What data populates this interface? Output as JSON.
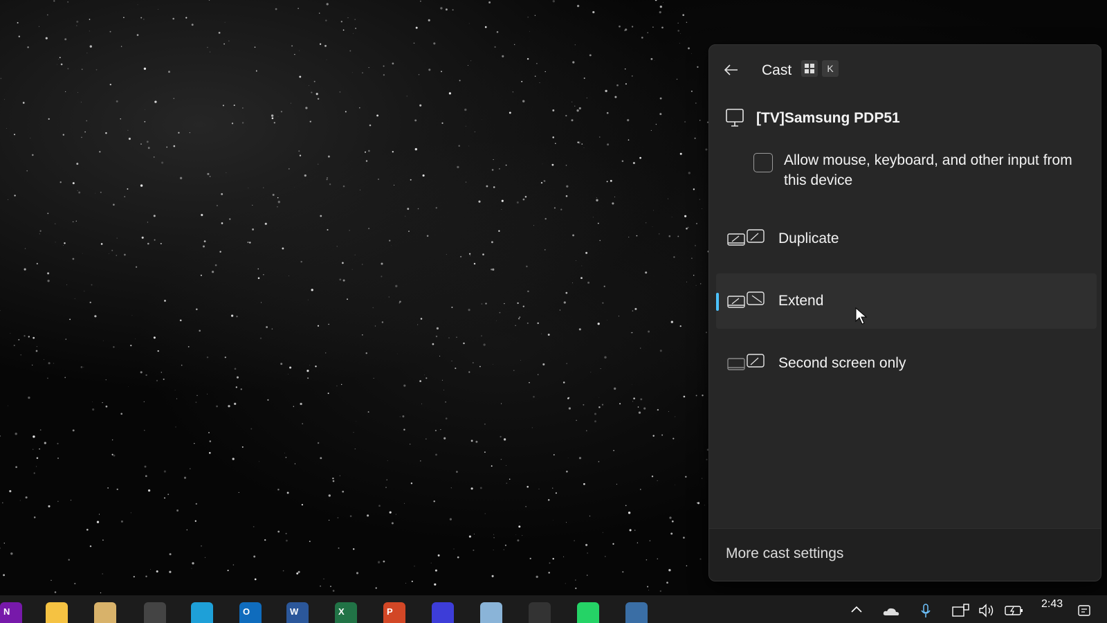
{
  "panel": {
    "title": "Cast",
    "shortcut_key": "K",
    "device_name": "[TV]Samsung PDP51",
    "input_label": "Allow mouse, keyboard, and other input from this device",
    "input_checked": false,
    "modes": [
      {
        "label": "Duplicate",
        "icon": "duplicate-display-icon",
        "selected": false
      },
      {
        "label": "Extend",
        "icon": "extend-display-icon",
        "selected": true
      },
      {
        "label": "Second screen only",
        "icon": "second-screen-only-icon",
        "selected": false
      }
    ],
    "more_settings_label": "More cast settings",
    "accent_color": "#4cc2ff"
  },
  "taskbar": {
    "apps": [
      {
        "name": "onenote-icon",
        "letter": "N",
        "color": "#7719aa"
      },
      {
        "name": "file-explorer-icon",
        "letter": "",
        "color": "#f5c242"
      },
      {
        "name": "photos-icon",
        "letter": "",
        "color": "#d8b26a"
      },
      {
        "name": "chrome-icon",
        "letter": "",
        "color": "#444444"
      },
      {
        "name": "edge-icon",
        "letter": "",
        "color": "#1ea0d8"
      },
      {
        "name": "outlook-icon",
        "letter": "O",
        "color": "#0f6cbd"
      },
      {
        "name": "word-icon",
        "letter": "W",
        "color": "#2b579a"
      },
      {
        "name": "excel-icon",
        "letter": "X",
        "color": "#217346"
      },
      {
        "name": "powerpoint-icon",
        "letter": "P",
        "color": "#d24726"
      },
      {
        "name": "paint-icon",
        "letter": "",
        "color": "#3d3dd8"
      },
      {
        "name": "snipping-tool-icon",
        "letter": "",
        "color": "#8ab4d8"
      },
      {
        "name": "app-icon",
        "letter": "",
        "color": "#333333"
      },
      {
        "name": "whatsapp-icon",
        "letter": "",
        "color": "#25d366"
      },
      {
        "name": "phone-link-icon",
        "letter": "",
        "color": "#3a6ea5"
      }
    ],
    "tray_icons": [
      "chevron-up-icon",
      "onedrive-icon",
      "microphone-icon",
      "network-icon",
      "volume-icon",
      "battery-icon"
    ],
    "time": "2:43"
  }
}
